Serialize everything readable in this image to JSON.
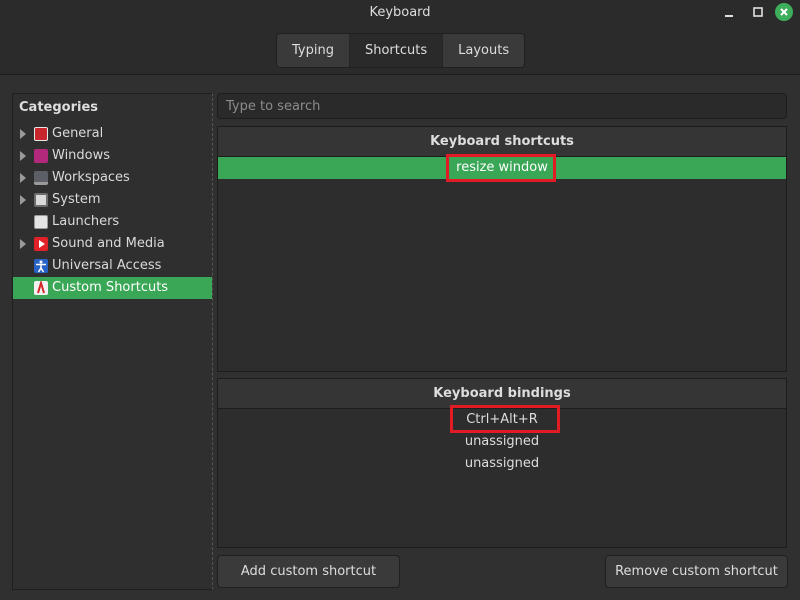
{
  "window": {
    "title": "Keyboard",
    "accent": "#3aa756",
    "close_color": "#3fae5a"
  },
  "tabs": [
    {
      "label": "Typing"
    },
    {
      "label": "Shortcuts"
    },
    {
      "label": "Layouts"
    }
  ],
  "categories": {
    "header": "Categories",
    "items": [
      {
        "label": "General",
        "icon": "general-icon",
        "expandable": true
      },
      {
        "label": "Windows",
        "icon": "windows-icon",
        "expandable": true
      },
      {
        "label": "Workspaces",
        "icon": "workspaces-icon",
        "expandable": true
      },
      {
        "label": "System",
        "icon": "system-icon",
        "expandable": true
      },
      {
        "label": "Launchers",
        "icon": "launchers-icon",
        "expandable": false
      },
      {
        "label": "Sound and Media",
        "icon": "sound-media-icon",
        "expandable": true
      },
      {
        "label": "Universal Access",
        "icon": "universal-access-icon",
        "expandable": false
      },
      {
        "label": "Custom Shortcuts",
        "icon": "custom-shortcuts-icon",
        "expandable": false,
        "selected": true
      }
    ]
  },
  "search": {
    "placeholder": "Type to search"
  },
  "shortcuts_panel": {
    "header": "Keyboard shortcuts",
    "items": [
      "resize window"
    ]
  },
  "bindings_panel": {
    "header": "Keyboard bindings",
    "items": [
      "Ctrl+Alt+R",
      "unassigned",
      "unassigned"
    ]
  },
  "buttons": {
    "add": "Add custom shortcut",
    "remove": "Remove custom shortcut"
  }
}
